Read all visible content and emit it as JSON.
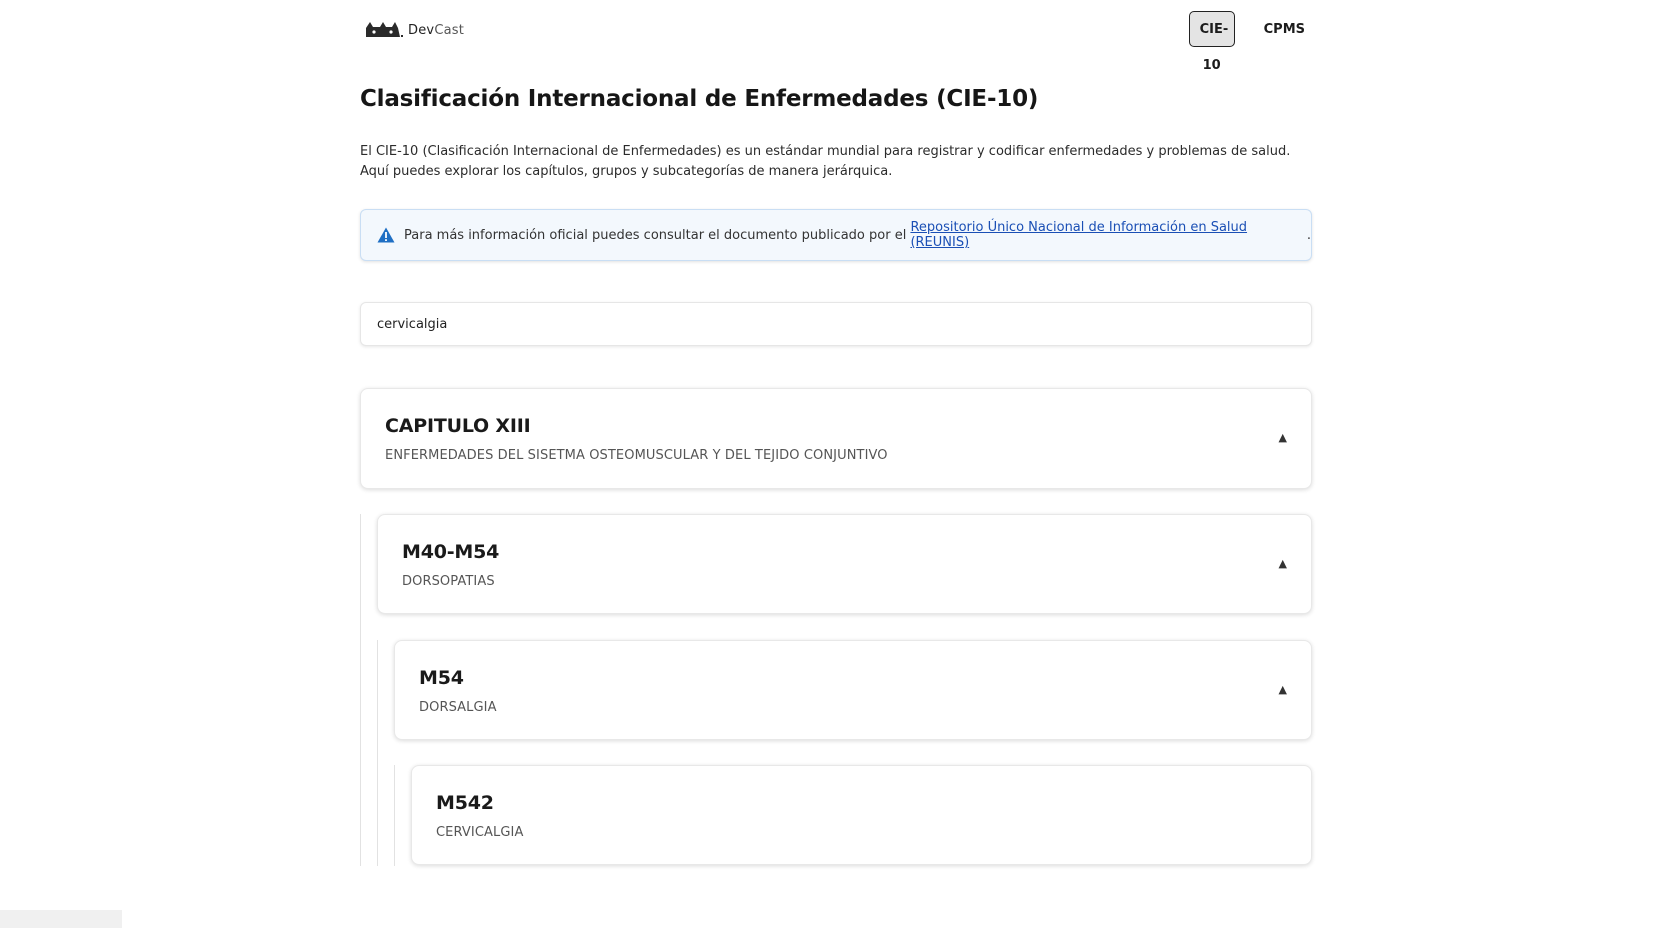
{
  "header": {
    "brand_dev": "Dev",
    "brand_cast": "Cast",
    "nav": [
      {
        "label": "CIE-10",
        "active": true
      },
      {
        "label": "CPMS",
        "active": false
      }
    ]
  },
  "main": {
    "title": "Clasificación Internacional de Enfermedades (CIE-10)",
    "intro": "El CIE-10 (Clasificación Internacional de Enfermedades) es un estándar mundial para registrar y codificar enfermedades y problemas de salud. Aquí puedes explorar los capítulos, grupos y subcategorías de manera jerárquica.",
    "notice": {
      "icon": "warning-triangle-icon",
      "text": "Para más información oficial puedes consultar el documento publicado por el ",
      "link_text": "Repositorio Único Nacional de Información en Salud (REUNIS) ",
      "suffix": "."
    },
    "search": {
      "value": "cervicalgia",
      "placeholder": ""
    },
    "tree": [
      {
        "code": "CAPITULO XIII",
        "description": "ENFERMEDADES DEL SISETMA OSTEOMUSCULAR Y DEL TEJIDO CONJUNTIVO",
        "expanded": true,
        "chevron": "▲"
      },
      {
        "code": "M40-M54",
        "description": "DORSOPATIAS",
        "expanded": true,
        "chevron": "▲"
      },
      {
        "code": "M54",
        "description": "DORSALGIA",
        "expanded": true,
        "chevron": "▲"
      },
      {
        "code": "M542",
        "description": "CERVICALGIA",
        "expanded": false,
        "chevron": ""
      }
    ]
  },
  "colors": {
    "accent": "#1a4fb5",
    "warning_icon": "#1f6fc4",
    "notice_bg": "#f3f8fd",
    "active_nav_bg": "#e4e4e4"
  }
}
